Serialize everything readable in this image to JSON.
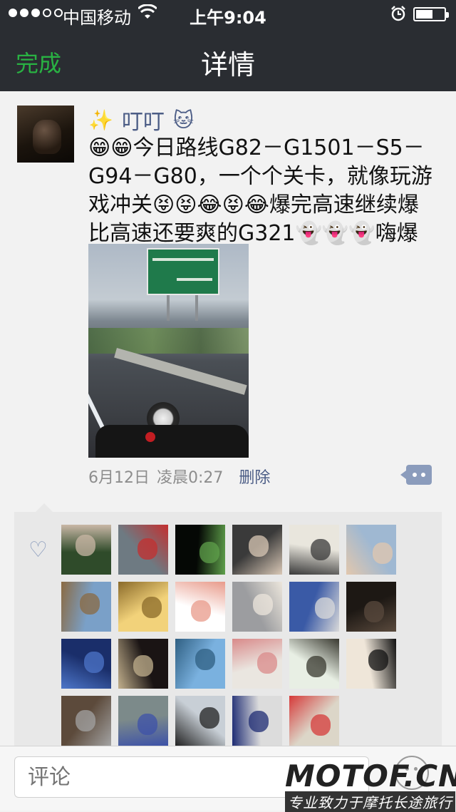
{
  "status_bar": {
    "carrier": "中国移动",
    "time": "上午9:04",
    "signal_bars_filled": 3,
    "signal_bars_total": 5,
    "battery_level": 0.62
  },
  "nav": {
    "done_label": "完成",
    "title": "详情"
  },
  "post": {
    "poster_name": "叮叮",
    "poster_prefix_emoji": "✨",
    "poster_suffix_emoji": "🐱",
    "text": "😁😁今日路线G82－G1501－S5－G94－G80，一个个关卡，就像玩游戏冲关😝😝😂😝😂爆完高速继续爆比高速还要爽的G321👻👻👻嗨爆了～",
    "date": "6月12日",
    "time": "凌晨0:27",
    "delete_label": "删除"
  },
  "likes": {
    "icon": "heart-outline",
    "avatars": [
      {
        "colors": [
          "#2f4b2a",
          "#c9b7a6"
        ]
      },
      {
        "colors": [
          "#6e7a82",
          "#c42f2f"
        ]
      },
      {
        "colors": [
          "#050805",
          "#5fa04b"
        ]
      },
      {
        "colors": [
          "#3a3a3a",
          "#d9c8b6"
        ]
      },
      {
        "colors": [
          "#e9e6dd",
          "#3a3a3a"
        ]
      },
      {
        "colors": [
          "#9fb8d2",
          "#e2c7ad"
        ]
      },
      {
        "colors": [
          "#7aa0c8",
          "#8b6a42"
        ]
      },
      {
        "colors": [
          "#f2d27a",
          "#8a6a2a"
        ]
      },
      {
        "colors": [
          "#ffffff",
          "#e89a8a"
        ]
      },
      {
        "colors": [
          "#9c9da0",
          "#ece6dc"
        ]
      },
      {
        "colors": [
          "#3a5aa6",
          "#d9d9d9"
        ]
      },
      {
        "colors": [
          "#1d1814",
          "#5a4a3d"
        ]
      },
      {
        "colors": [
          "#1a2e6a",
          "#4d76c9"
        ]
      },
      {
        "colors": [
          "#1a1414",
          "#c2b08d"
        ]
      },
      {
        "colors": [
          "#7ab1df",
          "#2f5f82"
        ]
      },
      {
        "colors": [
          "#eae6e0",
          "#d98a8a"
        ]
      },
      {
        "colors": [
          "#e8efe4",
          "#38382f"
        ]
      },
      {
        "colors": [
          "#efe6d9",
          "#111111"
        ]
      },
      {
        "colors": [
          "#5c4a3b",
          "#a3a3a3"
        ]
      },
      {
        "colors": [
          "#7c8a8a",
          "#3d52a8"
        ]
      },
      {
        "colors": [
          "#c8cfd6",
          "#222222"
        ]
      },
      {
        "colors": [
          "#dcdcdc",
          "#1d2b73"
        ]
      },
      {
        "colors": [
          "#dcd6c8",
          "#d63939"
        ]
      }
    ]
  },
  "comment_input": {
    "placeholder": "评论"
  },
  "watermark": {
    "logo": "MOTOF.CN",
    "sub": "专业致力于摩托长途旅行"
  }
}
